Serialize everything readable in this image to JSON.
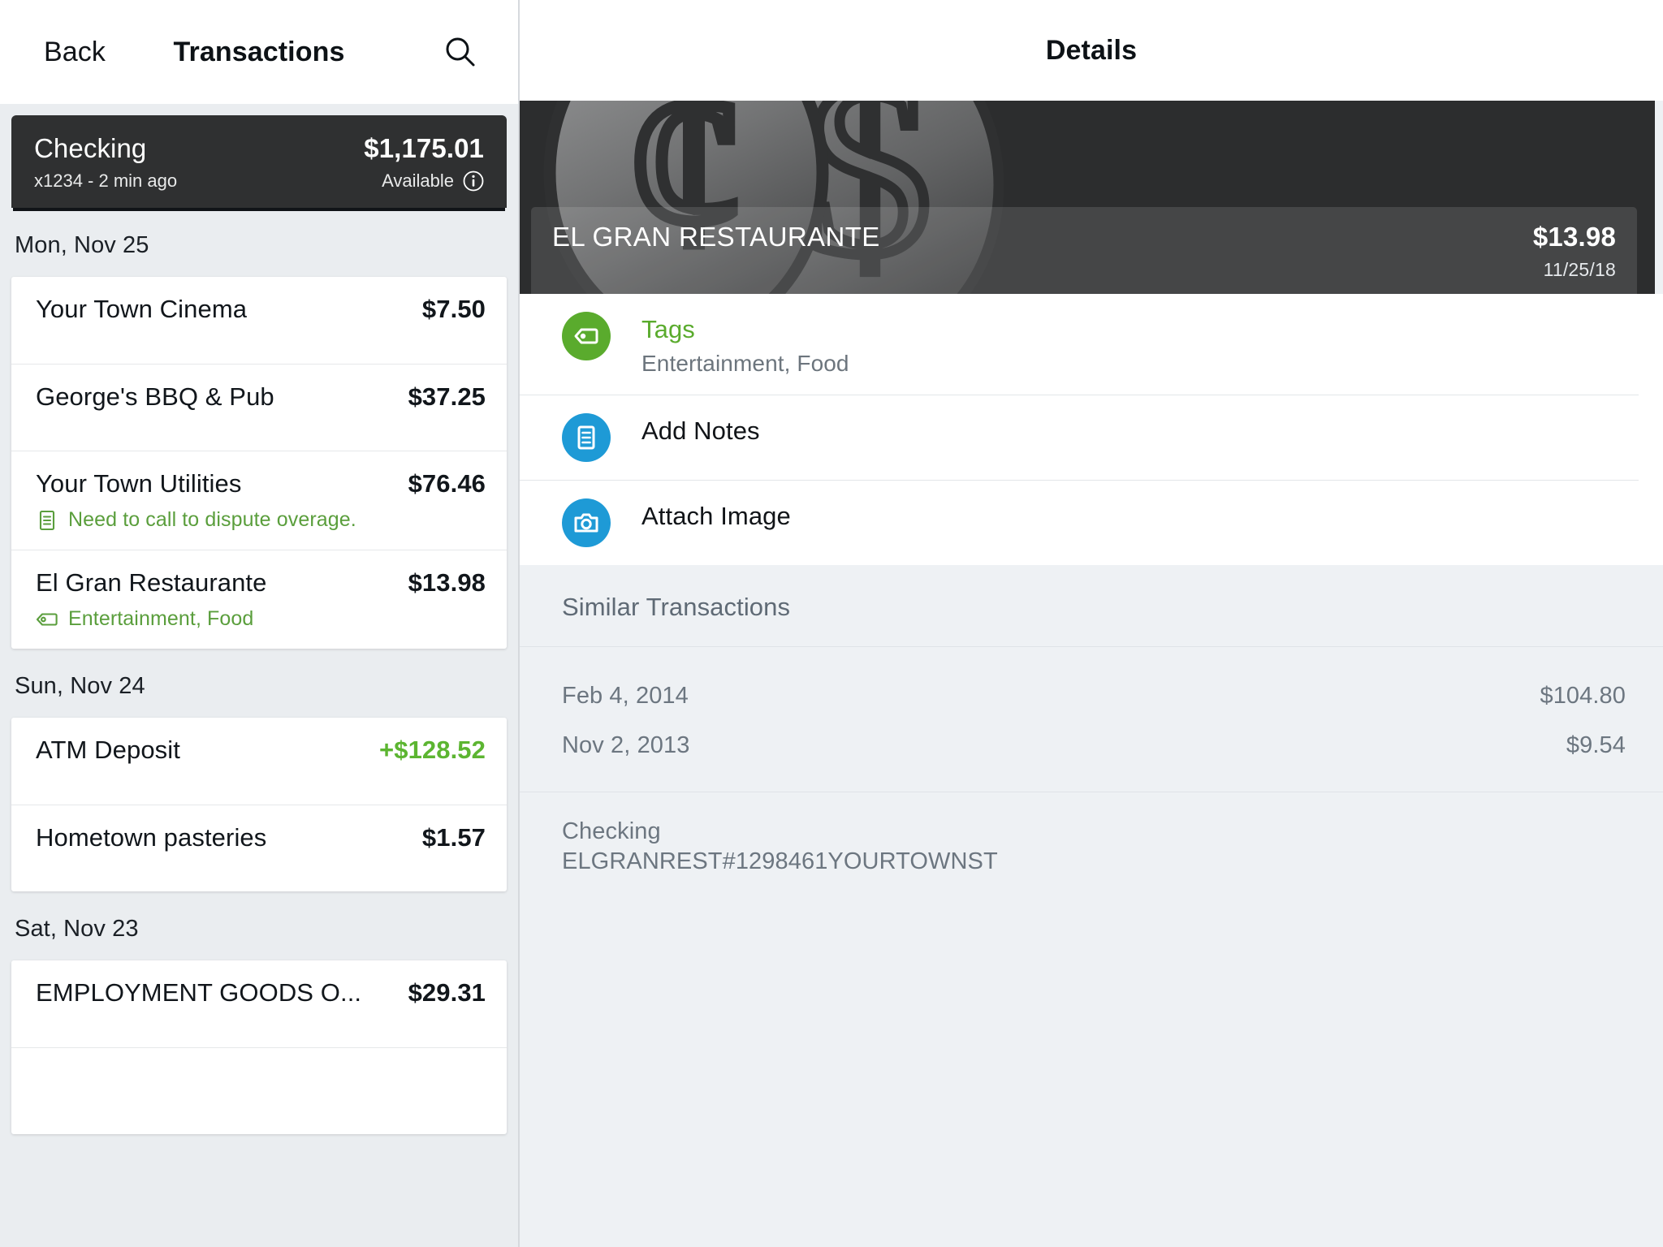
{
  "left": {
    "navbar": {
      "back_label": "Back",
      "title": "Transactions",
      "search_icon": "search-icon"
    },
    "account": {
      "name": "Checking",
      "balance": "$1,175.01",
      "sub": "x1234 - 2 min ago",
      "available_label": "Available",
      "info_icon": "info-circle-icon"
    },
    "groups": [
      {
        "date_label": "Mon, Nov 25",
        "transactions": [
          {
            "name": "Your Town Cinema",
            "amount": "$7.50",
            "credit": false,
            "meta": null,
            "meta_icon": null
          },
          {
            "name": "George's BBQ & Pub",
            "amount": "$37.25",
            "credit": false,
            "meta": null,
            "meta_icon": null
          },
          {
            "name": "Your Town Utilities",
            "amount": "$76.46",
            "credit": false,
            "meta": "Need to call to dispute overage.",
            "meta_icon": "note-icon"
          },
          {
            "name": "El Gran Restaurante",
            "amount": "$13.98",
            "credit": false,
            "meta": "Entertainment, Food",
            "meta_icon": "tag-icon"
          }
        ]
      },
      {
        "date_label": "Sun, Nov 24",
        "transactions": [
          {
            "name": "ATM Deposit",
            "amount": "+$128.52",
            "credit": true,
            "meta": null,
            "meta_icon": null
          },
          {
            "name": "Hometown pasteries",
            "amount": "$1.57",
            "credit": false,
            "meta": null,
            "meta_icon": null
          }
        ]
      },
      {
        "date_label": "Sat, Nov 23",
        "transactions": [
          {
            "name": "EMPLOYMENT GOODS O...",
            "amount": "$29.31",
            "credit": false,
            "meta": null,
            "meta_icon": null
          },
          {
            "name": "",
            "amount": "",
            "credit": false,
            "meta": null,
            "meta_icon": null
          }
        ]
      }
    ]
  },
  "right": {
    "navbar": {
      "title": "Details"
    },
    "hero": {
      "merchant": "EL GRAN RESTAURANTE",
      "amount": "$13.98",
      "date": "11/25/18",
      "background_icon": "coins-dollar-cent-icon"
    },
    "actions": [
      {
        "title": "Tags",
        "subtitle": "Entertainment, Food",
        "icon": "tag-icon",
        "icon_color": "#5aab2d",
        "title_green": true
      },
      {
        "title": "Add Notes",
        "subtitle": null,
        "icon": "note-icon",
        "icon_color": "#1e9ad6",
        "title_green": false
      },
      {
        "title": "Attach Image",
        "subtitle": null,
        "icon": "camera-icon",
        "icon_color": "#1e9ad6",
        "title_green": false
      }
    ],
    "similar": {
      "header": "Similar Transactions",
      "rows": [
        {
          "date": "Feb 4, 2014",
          "amount": "$104.80"
        },
        {
          "date": "Nov 2, 2013",
          "amount": "$9.54"
        }
      ]
    },
    "description": {
      "account": "Checking",
      "raw": "ELGRANREST#1298461YOURTOWNST"
    }
  },
  "colors": {
    "accent_green": "#5aab2d",
    "accent_blue": "#1e9ad6",
    "dark_card": "#2f3031",
    "page_bg": "#eaedf0",
    "muted_text": "#6c7680"
  }
}
